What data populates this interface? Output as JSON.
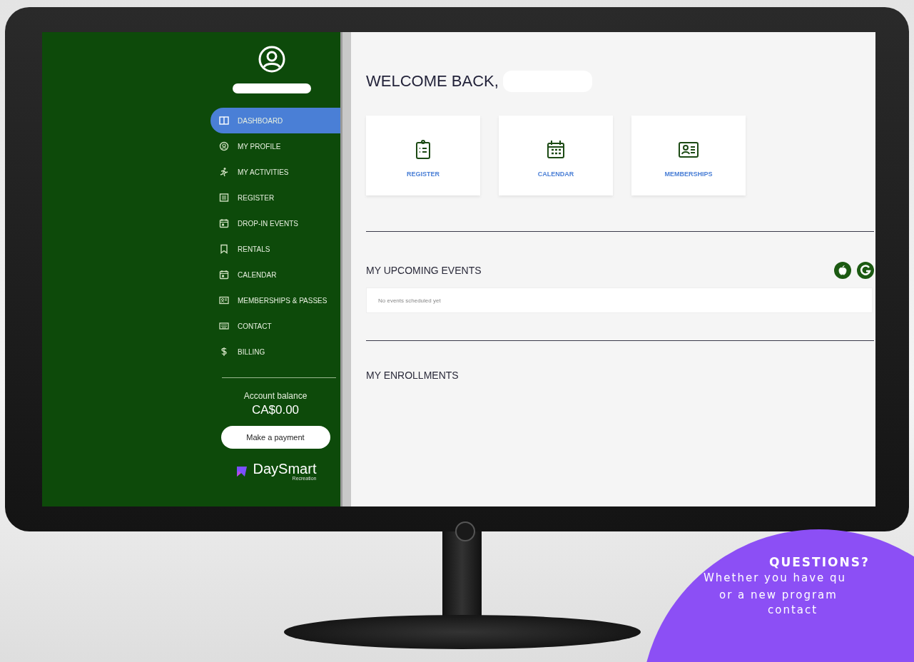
{
  "sidebar": {
    "nav": [
      {
        "label": "DASHBOARD",
        "selected": true
      },
      {
        "label": "MY PROFILE",
        "selected": false
      },
      {
        "label": "MY ACTIVITIES",
        "selected": false
      },
      {
        "label": "REGISTER",
        "selected": false
      },
      {
        "label": "DROP-IN EVENTS",
        "selected": false
      },
      {
        "label": "RENTALS",
        "selected": false
      },
      {
        "label": "CALENDAR",
        "selected": false
      },
      {
        "label": "MEMBERSHIPS & PASSES",
        "selected": false
      },
      {
        "label": "CONTACT",
        "selected": false
      },
      {
        "label": "BILLING",
        "selected": false
      }
    ],
    "balance_label": "Account balance",
    "balance": "CA$0.00",
    "payment_button": "Make a payment",
    "brand": "DaySmart",
    "brand_sub": "Recreation"
  },
  "main": {
    "welcome": "WELCOME BACK,",
    "quick_links": [
      "REGISTER",
      "CALENDAR",
      "MEMBERSHIPS"
    ],
    "upcoming": {
      "title": "MY UPCOMING EVENTS",
      "empty": "No events scheduled yet"
    },
    "enrollments": {
      "title": "MY ENROLLMENTS"
    }
  },
  "promo": {
    "title": "QUESTIONS?",
    "lines": [
      "Whether you have qu",
      "or a new program",
      "contact"
    ]
  }
}
